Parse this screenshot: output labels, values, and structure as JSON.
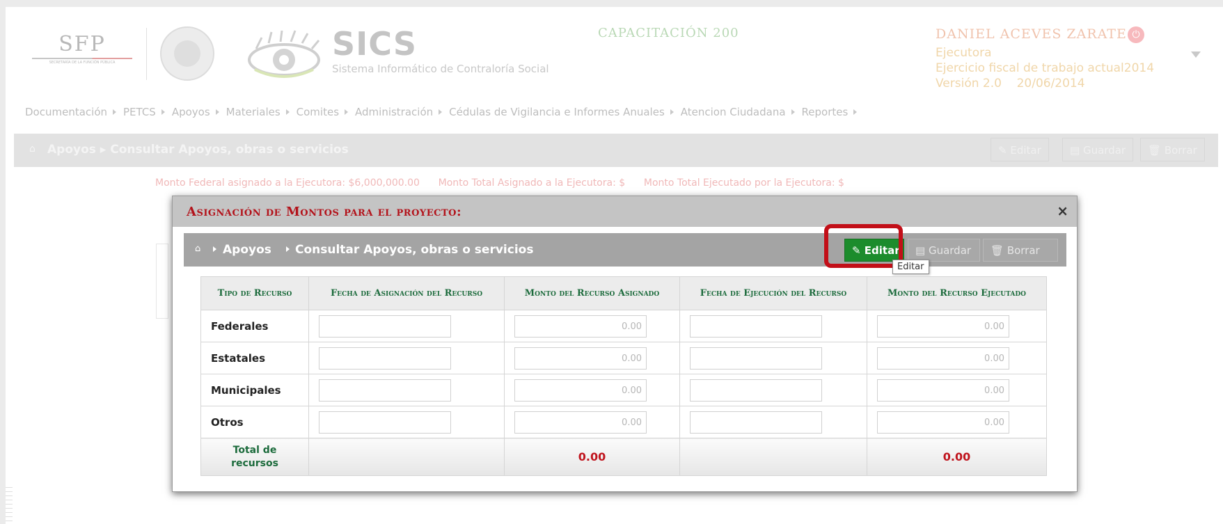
{
  "header": {
    "sfp_logo": "SFP",
    "sfp_sub": "SECRETARÍA DE LA FUNCIÓN PÚBLICA",
    "app_title": "SICS",
    "app_subtitle": "Sistema Informático de Contraloría Social",
    "environment": "CAPACITACIÓN 200",
    "user_name": "DANIEL ACEVES ZARATE",
    "role": "Ejecutora",
    "fiscal_year": "Ejercicio fiscal de trabajo actual2014",
    "version": "Versión 2.0",
    "version_date": "20/06/2014"
  },
  "menu": [
    "Documentación",
    "PETCS",
    "Apoyos",
    "Materiales",
    "Comites",
    "Administración",
    "Cédulas de Vigilancia e Informes Anuales",
    "Atencion Ciudadana",
    "Reportes"
  ],
  "breadcrumb": {
    "section": "Apoyos",
    "page": "Consultar Apoyos, obras o servicios"
  },
  "toolbar": {
    "edit": "Editar",
    "save": "Guardar",
    "delete": "Borrar"
  },
  "montos": {
    "federal": "Monto Federal asignado a la Ejecutora: $6,000,000.00",
    "total_asignado": "Monto Total Asignado a la Ejecutora: $",
    "total_ejecutado": "Monto Total Ejecutado por la Ejecutora: $"
  },
  "modal": {
    "title": "Asignación de Montos para el proyecto:",
    "close": "×",
    "tooltip": "Editar",
    "columns": [
      "Tipo de Recurso",
      "Fecha de Asignación del Recurso",
      "Monto del Recurso Asignado",
      "Fecha de Ejecución del Recurso",
      "Monto del Recurso Ejecutado"
    ],
    "rows": [
      {
        "tipo": "Federales",
        "fecha_asig": "",
        "monto_asig": "0.00",
        "fecha_ejec": "",
        "monto_ejec": "0.00"
      },
      {
        "tipo": "Estatales",
        "fecha_asig": "",
        "monto_asig": "0.00",
        "fecha_ejec": "",
        "monto_ejec": "0.00"
      },
      {
        "tipo": "Municipales",
        "fecha_asig": "",
        "monto_asig": "0.00",
        "fecha_ejec": "",
        "monto_ejec": "0.00"
      },
      {
        "tipo": "Otros",
        "fecha_asig": "",
        "monto_asig": "0.00",
        "fecha_ejec": "",
        "monto_ejec": "0.00"
      }
    ],
    "total_label": "Total de recursos",
    "total_asignado": "0.00",
    "total_ejecutado": "0.00"
  }
}
